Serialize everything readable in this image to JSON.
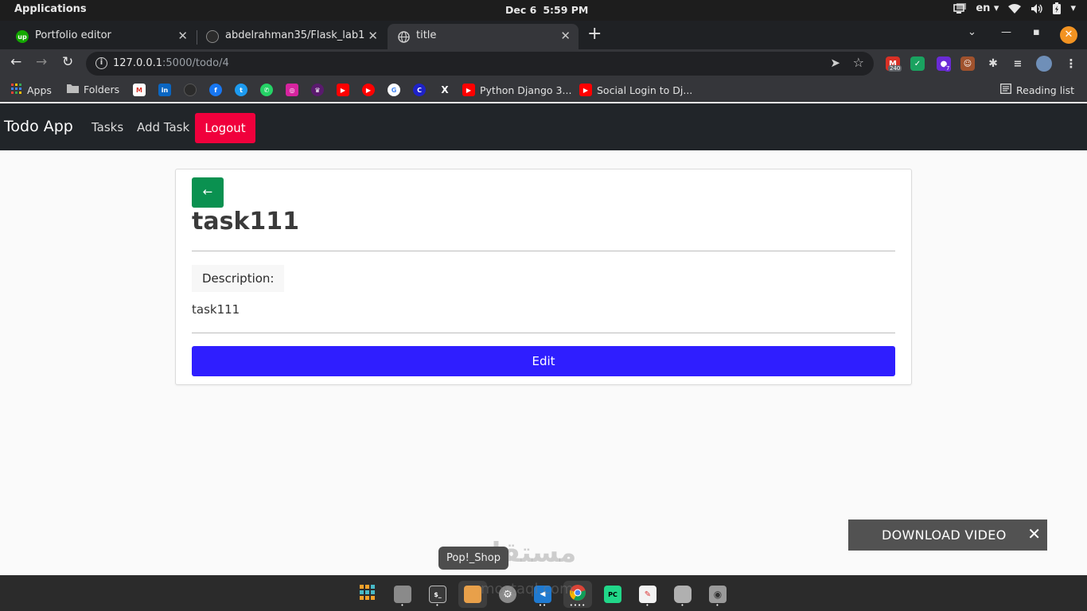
{
  "os_topbar": {
    "apps_label": "Applications",
    "date": "Dec 6",
    "time": "5:59 PM",
    "language": "en"
  },
  "browser": {
    "tabs": [
      {
        "title": "Portfolio editor",
        "favicon": "upwork-icon",
        "favicon_color": "#14a800"
      },
      {
        "title": "abdelrahman35/Flask_lab1",
        "favicon": "github-icon",
        "favicon_color": "#2b2b2b"
      },
      {
        "title": "title",
        "favicon": "globe-icon",
        "favicon_color": "#35363a"
      }
    ],
    "url_host": "127.0.0.1",
    "url_path": ":5000/todo/4",
    "extensions": [
      {
        "name": "gmail-extension-icon",
        "badge": "240",
        "color": "#d93025"
      },
      {
        "name": "shield-extension-icon",
        "badge": "",
        "color": "#1aa260"
      },
      {
        "name": "purple-extension-icon",
        "badge": "7",
        "color": "#6a2bd6"
      },
      {
        "name": "monkey-extension-icon",
        "badge": "",
        "color": "#a0522d"
      }
    ],
    "bookmarks": {
      "apps": "Apps",
      "folders": "Folders",
      "python_django": "Python Django 3...",
      "social_login": "Social Login to Dj...",
      "reading_list": "Reading list"
    }
  },
  "app": {
    "brand": "Todo App",
    "nav": {
      "tasks": "Tasks",
      "add_task": "Add Task",
      "logout": "Logout"
    },
    "task": {
      "back_label": "←",
      "title": "task111",
      "description_label": "Description:",
      "description": "task111",
      "edit_label": "Edit"
    },
    "colors": {
      "navbar": "#212529",
      "logout": "#f0003c",
      "back": "#0a9150",
      "edit": "#2f1eff"
    }
  },
  "overlay": {
    "download_video": "DOWNLOAD VIDEO",
    "close": "✕"
  },
  "dock": {
    "tooltip": "Pop!_Shop",
    "watermark": "مستقل",
    "watermark_sub": "mostaql.com"
  }
}
